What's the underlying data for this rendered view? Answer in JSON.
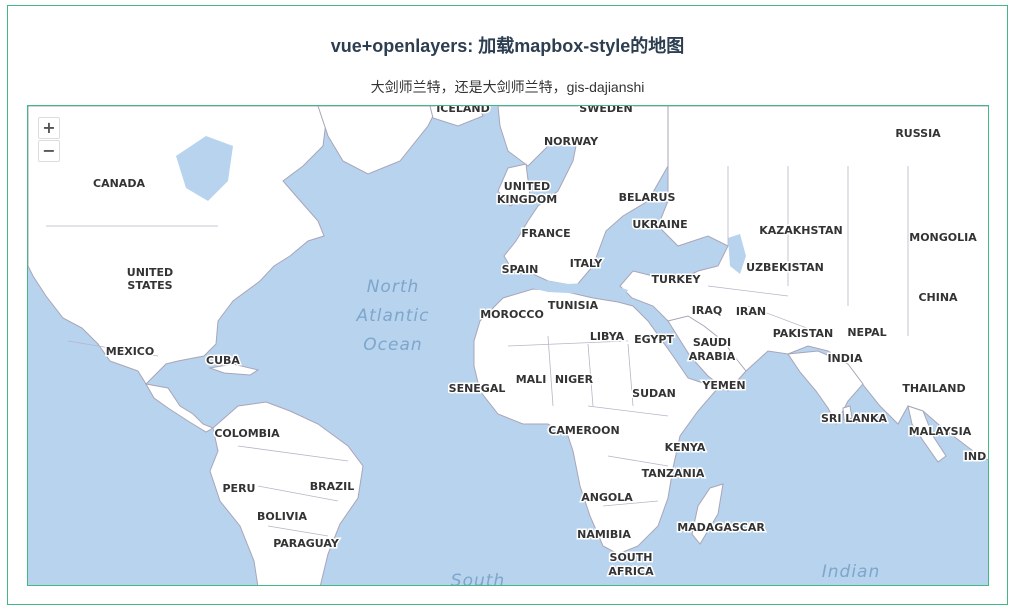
{
  "header": {
    "title": "vue+openlayers: 加载mapbox-style的地图",
    "subtitle": "大剑师兰特，还是大剑师兰特，gis-dajianshi"
  },
  "map": {
    "zoom_in": "+",
    "zoom_out": "−",
    "country_labels": [
      "ICELAND",
      "SWEDEN",
      "NORWAY",
      "RUSSIA",
      "CANADA",
      "UNITED",
      "KINGDOM",
      "BELARUS",
      "UKRAINE",
      "KAZAKHSTAN",
      "MONGOLIA",
      "FRANCE",
      "UNITED",
      "STATES",
      "SPAIN",
      "ITALY",
      "UZBEKISTAN",
      "TURKEY",
      "CHINA",
      "TUNISIA",
      "MOROCCO",
      "IRAQ",
      "IRAN",
      "LIBYA",
      "EGYPT",
      "PAKISTAN",
      "NEPAL",
      "MEXICO",
      "CUBA",
      "SAUDI",
      "ARABIA",
      "INDIA",
      "MALI",
      "NIGER",
      "SENEGAL",
      "YEMEN",
      "THAILAND",
      "SUDAN",
      "SRI LANKA",
      "COLOMBIA",
      "CAMEROON",
      "KENYA",
      "MALAYSIA",
      "IND",
      "TANZANIA",
      "PERU",
      "BRAZIL",
      "BOLIVIA",
      "ANGOLA",
      "PARAGUAY",
      "NAMIBIA",
      "MADAGASCAR",
      "SOUTH",
      "AFRICA"
    ],
    "ocean_labels": [
      "North",
      "Atlantic",
      "Ocean",
      "South",
      "Indian"
    ],
    "colors": {
      "land": "#ffffff",
      "water": "#b7d3ee",
      "border": "#a9a5b8",
      "accent": "#42b983"
    }
  }
}
